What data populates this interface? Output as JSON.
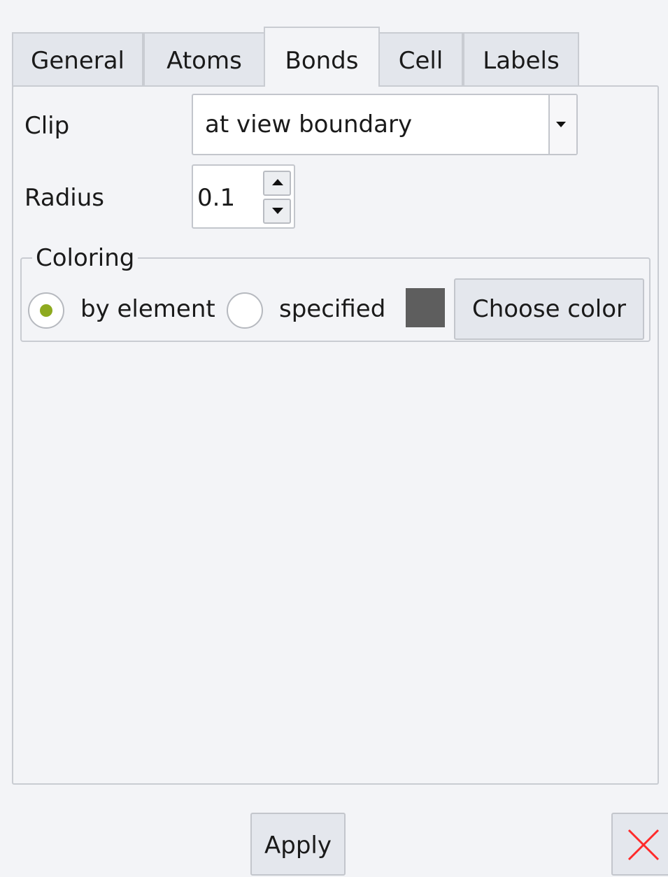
{
  "tabs": [
    {
      "label": "General",
      "active": false
    },
    {
      "label": "Atoms",
      "active": false
    },
    {
      "label": "Bonds",
      "active": true
    },
    {
      "label": "Cell",
      "active": false
    },
    {
      "label": "Labels",
      "active": false
    }
  ],
  "bonds": {
    "clip": {
      "label": "Clip",
      "value": "at view boundary"
    },
    "radius": {
      "label": "Radius",
      "value": "0.1"
    },
    "coloring": {
      "title": "Coloring",
      "options": [
        {
          "label": "by element",
          "selected": true
        },
        {
          "label": "specified",
          "selected": false
        }
      ],
      "swatch_color": "#5e5e5e",
      "choose_label": "Choose color"
    }
  },
  "footer": {
    "apply_label": "Apply",
    "close_icon": "close-icon"
  },
  "colors": {
    "radio_selected": "#8eaa1f",
    "close_icon": "#ff2a2a",
    "panel_bg": "#f3f4f7"
  }
}
